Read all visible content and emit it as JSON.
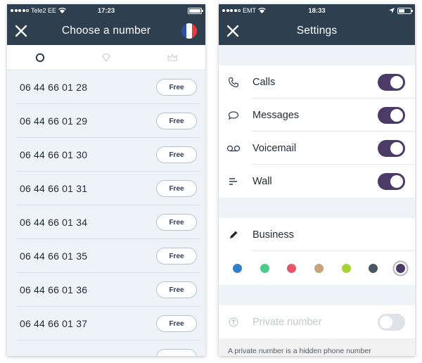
{
  "left_screen": {
    "status": {
      "carrier": "Tele2 EE",
      "time": "17:23"
    },
    "nav": {
      "title": "Choose a number"
    },
    "tabs": [
      {
        "icon": "circle-icon",
        "selected": true
      },
      {
        "icon": "diamond-icon",
        "selected": false
      },
      {
        "icon": "crown-icon",
        "selected": false
      }
    ],
    "numbers": [
      {
        "number": "06 44 66 01 28",
        "button": "Free"
      },
      {
        "number": "06 44 66 01 29",
        "button": "Free"
      },
      {
        "number": "06 44 66 01 30",
        "button": "Free"
      },
      {
        "number": "06 44 66 01 31",
        "button": "Free"
      },
      {
        "number": "06 44 66 01 34",
        "button": "Free"
      },
      {
        "number": "06 44 66 01 35",
        "button": "Free"
      },
      {
        "number": "06 44 66 01 36",
        "button": "Free"
      },
      {
        "number": "06 44 66 01 37",
        "button": "Free"
      },
      {
        "number": "",
        "button": ""
      }
    ],
    "flag_colors": [
      "#2c4fa3",
      "#ffffff",
      "#e23b40"
    ]
  },
  "right_screen": {
    "status": {
      "carrier": "EMT",
      "time": "18:33"
    },
    "nav": {
      "title": "Settings"
    },
    "notifications": [
      {
        "icon": "phone-icon",
        "label": "Calls",
        "enabled": true
      },
      {
        "icon": "chat-bubble-icon",
        "label": "Messages",
        "enabled": true
      },
      {
        "icon": "voicemail-icon",
        "label": "Voicemail",
        "enabled": true
      },
      {
        "icon": "wall-icon",
        "label": "Wall",
        "enabled": true
      }
    ],
    "business": {
      "icon": "pencil-icon",
      "label": "Business",
      "colors": [
        "#2f7fcb",
        "#4ccb8c",
        "#e8566b",
        "#c5a47a",
        "#a7d233",
        "#4a5866",
        "#4b3b66"
      ],
      "selected_color": "#4b3b66"
    },
    "private": {
      "icon": "upload-circle-icon",
      "label": "Private number",
      "enabled": false
    },
    "note": "A private number is a hidden phone number"
  },
  "colors": {
    "header": "#2e3f4f",
    "toggle_on": "#4b3b66",
    "list_bg": "#eef3f8"
  }
}
